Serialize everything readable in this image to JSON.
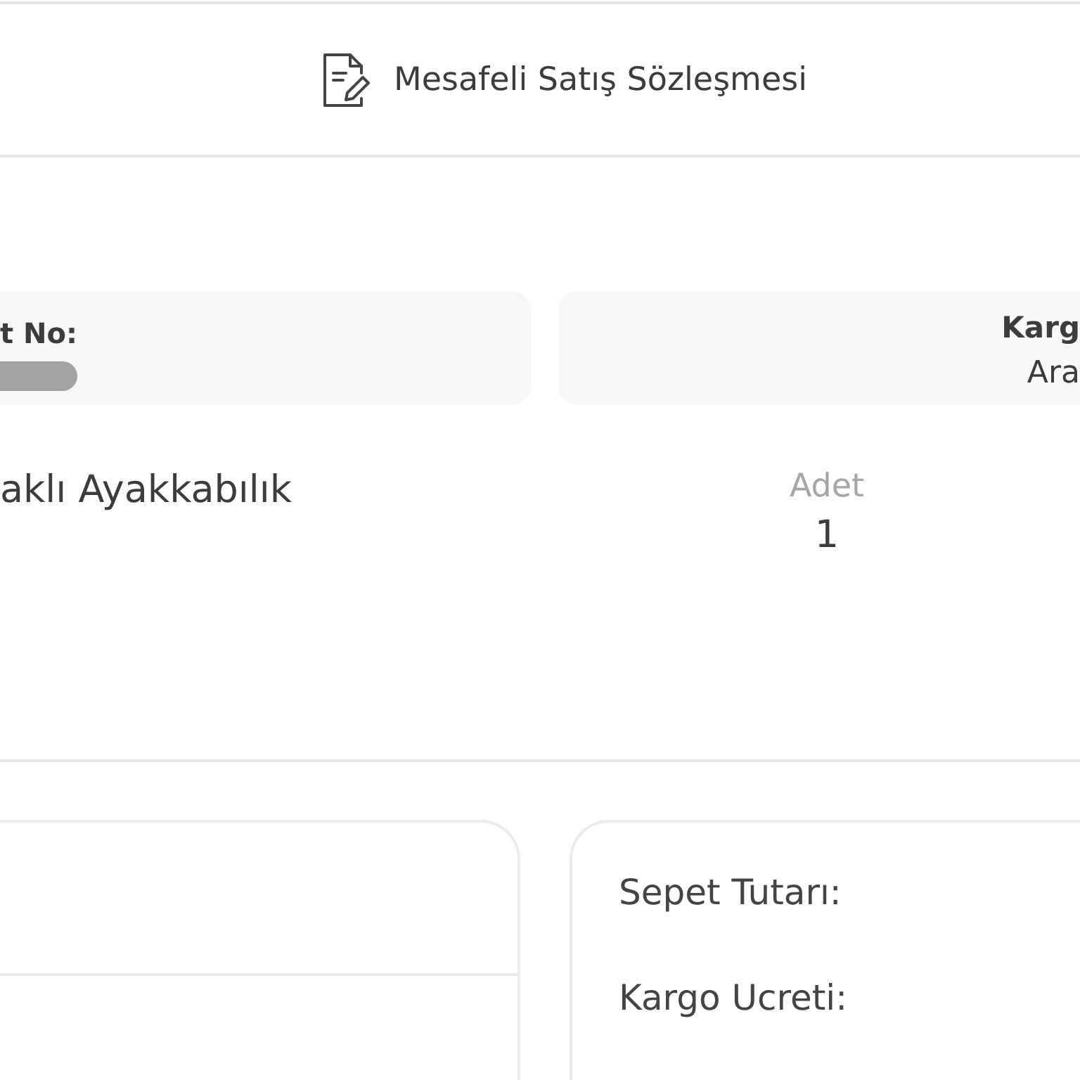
{
  "header": {
    "title": "Mesafeli Satış Sözleşmesi"
  },
  "order_card": {
    "label": "t No:",
    "redacted": true
  },
  "shipping_card": {
    "label": "Karg",
    "value": "Ara"
  },
  "product": {
    "name": "aklı Ayakkabılık",
    "quantity_label": "Adet",
    "quantity": "1"
  },
  "totals": {
    "rows": [
      {
        "label": "Sepet Tutarı:"
      },
      {
        "label": "Kargo Ucreti:"
      }
    ]
  }
}
